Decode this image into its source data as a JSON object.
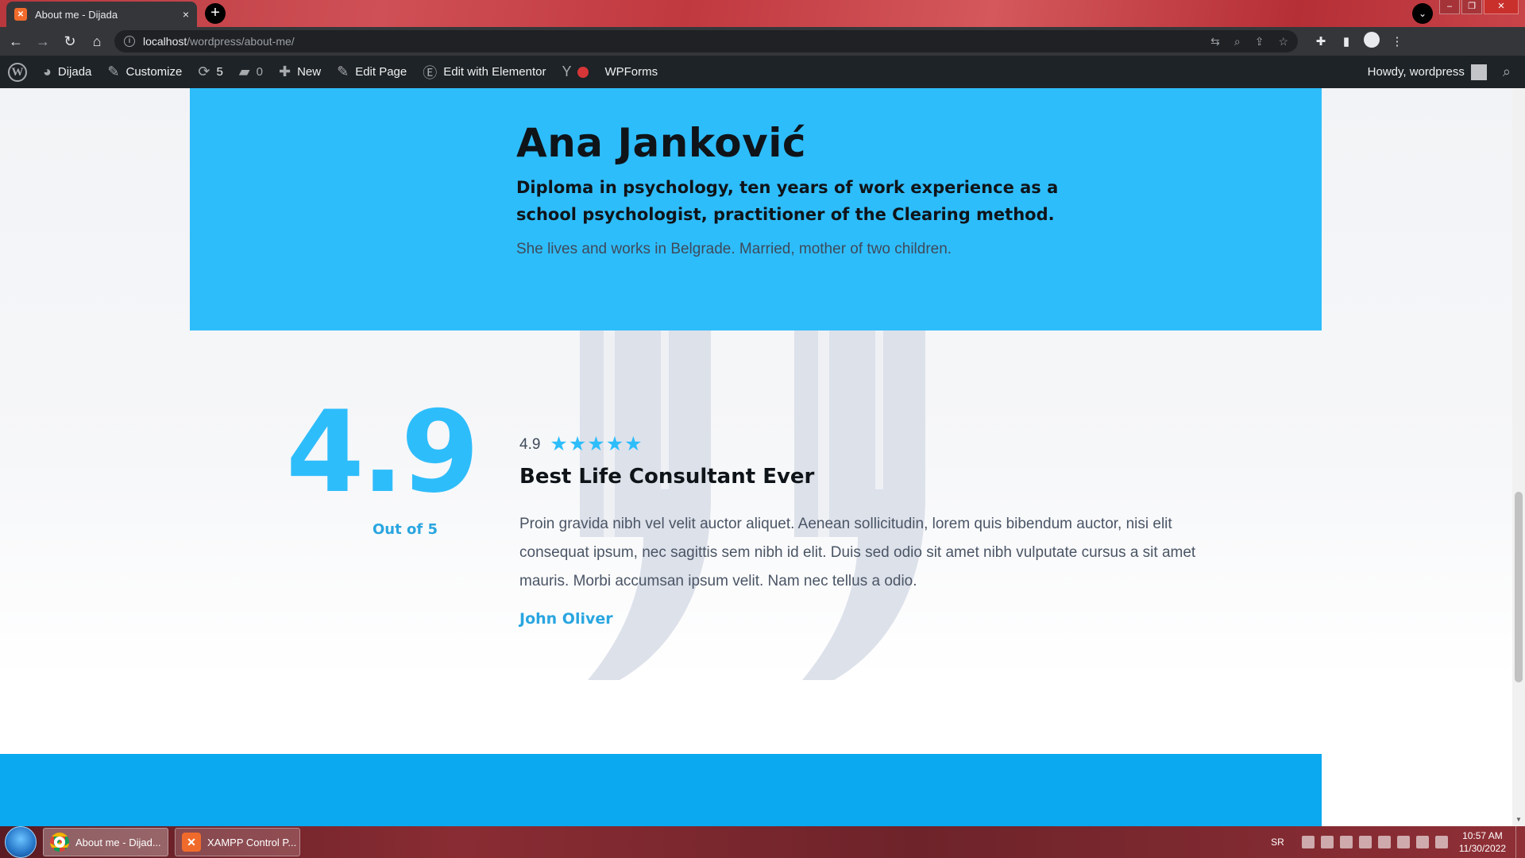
{
  "browser": {
    "tab_title": "About me - Dijada",
    "tab_close": "×",
    "new_tab": "+",
    "tab_search": "⌄",
    "window_controls": {
      "minimize": "–",
      "restore": "❐",
      "close": "✕"
    },
    "url_host": "localhost",
    "url_path": "/wordpress/about-me/",
    "nav": {
      "back": "←",
      "forward": "→",
      "reload": "↻",
      "home": "⌂"
    }
  },
  "adminbar": {
    "site": "Dijada",
    "customize": "Customize",
    "updates_count": "5",
    "comments_count": "0",
    "new": "New",
    "edit_page": "Edit Page",
    "edit_elementor": "Edit with Elementor",
    "wpforms": "WPForms",
    "howdy": "Howdy, wordpress"
  },
  "hero": {
    "name": "Ana Janković",
    "subtitle": "Diploma in psychology, ten years of work experience as a school psychologist, practitioner of the Clearing method.",
    "bio": "She lives and works in Belgrade. Married, mother of two children."
  },
  "rating": {
    "score": "4.9",
    "out_of": "Out of 5",
    "stars_value": 4.9,
    "stars_max": 5
  },
  "review": {
    "rating": "4.9",
    "title": "Best Life Consultant Ever",
    "body": "Proin gravida nibh vel velit auctor aliquet. Aenean sollicitudin, lorem quis bibendum auctor, nisi elit consequat ipsum, nec sagittis sem nibh id elit. Duis sed odio sit amet nibh vulputate cursus a sit amet mauris. Morbi accumsan ipsum velit. Nam nec tellus a odio.",
    "author": "John Oliver"
  },
  "taskbar": {
    "items": [
      {
        "label": "About me - Dijad..."
      },
      {
        "label": "XAMPP Control P..."
      }
    ],
    "language": "SR",
    "time": "10:57 AM",
    "date": "11/30/2022"
  },
  "colors": {
    "accent": "#2ebdfb",
    "footer": "#0aa9f0",
    "admin_bar": "#1d2327"
  }
}
